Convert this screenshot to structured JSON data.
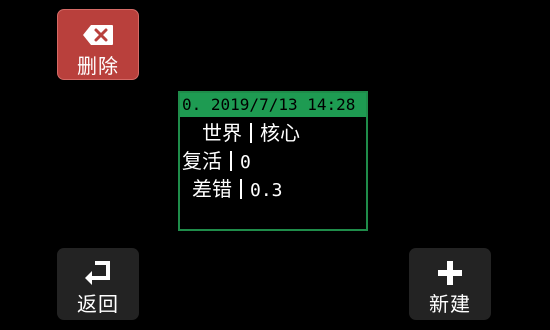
{
  "buttons": {
    "delete": {
      "label": "删除",
      "icon": "backspace-x-icon",
      "color": "#b9403c"
    },
    "back": {
      "label": "返回",
      "icon": "return-arrow-icon"
    },
    "new": {
      "label": "新建",
      "icon": "plus-icon"
    }
  },
  "card": {
    "header": "0. 2019/7/13 14:28",
    "header_color": "#1e9b52",
    "rows": [
      {
        "key": "世界",
        "value": "核心"
      },
      {
        "key": "复活",
        "value": "0"
      },
      {
        "key": "差错",
        "value": "0.3"
      }
    ]
  }
}
